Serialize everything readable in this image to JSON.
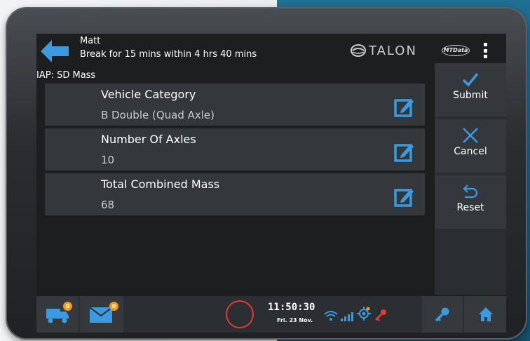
{
  "header": {
    "driver_name": "Matt",
    "break_notice": "Break for 15 mins within 4 hrs 40 mins",
    "brand_logo_text": "TALON",
    "partner_logo_text": "MTData"
  },
  "form": {
    "title": "IAP: SD Mass",
    "fields": [
      {
        "label": "Vehicle Category",
        "value": "B Double (Quad Axle)"
      },
      {
        "label": "Number Of Axles",
        "value": "10"
      },
      {
        "label": "Total Combined Mass",
        "value": "68"
      }
    ]
  },
  "actions": {
    "submit": "Submit",
    "cancel": "Cancel",
    "reset": "Reset"
  },
  "footer": {
    "jobs_badge": "0",
    "messages_badge": "0",
    "time": "11:50:30",
    "date": "Fri. 23 Nov."
  },
  "colors": {
    "accent_blue": "#3a9be0",
    "alert_orange": "#f39a1e",
    "record_red": "#e23a33",
    "key_red": "#e53b34"
  },
  "icons": [
    "back-arrow-icon",
    "menu-dots-icon",
    "edit-icon",
    "checkmark-icon",
    "close-icon",
    "undo-icon",
    "truck-icon",
    "envelope-icon",
    "record-icon",
    "wifi-icon",
    "signal-icon",
    "gps-icon",
    "red-key-icon",
    "key-icon",
    "home-icon"
  ]
}
